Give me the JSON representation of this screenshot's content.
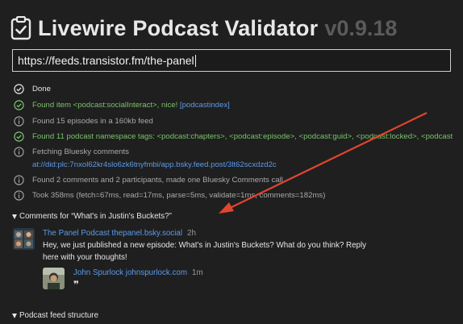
{
  "header": {
    "title": "Livewire Podcast Validator",
    "version": "v0.9.18",
    "icon": "clipboard-check-icon"
  },
  "url_input": {
    "value": "https://feeds.transistor.fm/the-panel"
  },
  "log": [
    {
      "status": "done",
      "text": "Done"
    },
    {
      "status": "ok",
      "text": "Found item <podcast:socialInteract>, nice!",
      "link": "[podcastindex]"
    },
    {
      "status": "info",
      "text": "Found 15 episodes in a 160kb feed"
    },
    {
      "status": "ok",
      "text": "Found 11 podcast namespace tags: <podcast:chapters>, <podcast:episode>, <podcast:guid>, <podcast:locked>, <podcast"
    },
    {
      "status": "info",
      "text": "Fetching Bluesky comments",
      "link": "at://did:plc:7nxol62kr4slo6zk6tnyfmbi/app.bsky.feed.post/3lt62scxdzd2c"
    },
    {
      "status": "info",
      "text": "Found 2 comments and 2 participants, made one Bluesky Comments call"
    },
    {
      "status": "info",
      "text": "Took 358ms (fetch=67ms, read=17ms, parse=5ms, validate=1ms, comments=182ms)"
    }
  ],
  "comments_section": {
    "label": "Comments for “What's in Justin's Buckets?”",
    "comments": [
      {
        "author": "The Panel Podcast thepanel.bsky.social",
        "time": "2h",
        "text_line1": "Hey, we just published a new episode: What's in Justin's Buckets? What do you think? Reply",
        "text_line2": "here with your thoughts!"
      },
      {
        "author": "John Spurlock johnspurlock.com",
        "time": "1m",
        "text": "❞"
      }
    ]
  },
  "feed_section": {
    "label": "Podcast feed structure"
  },
  "colors": {
    "background": "#1f1f1f",
    "success": "#7bc26a",
    "link": "#5b9bea",
    "annotation_arrow": "#e0452f"
  }
}
